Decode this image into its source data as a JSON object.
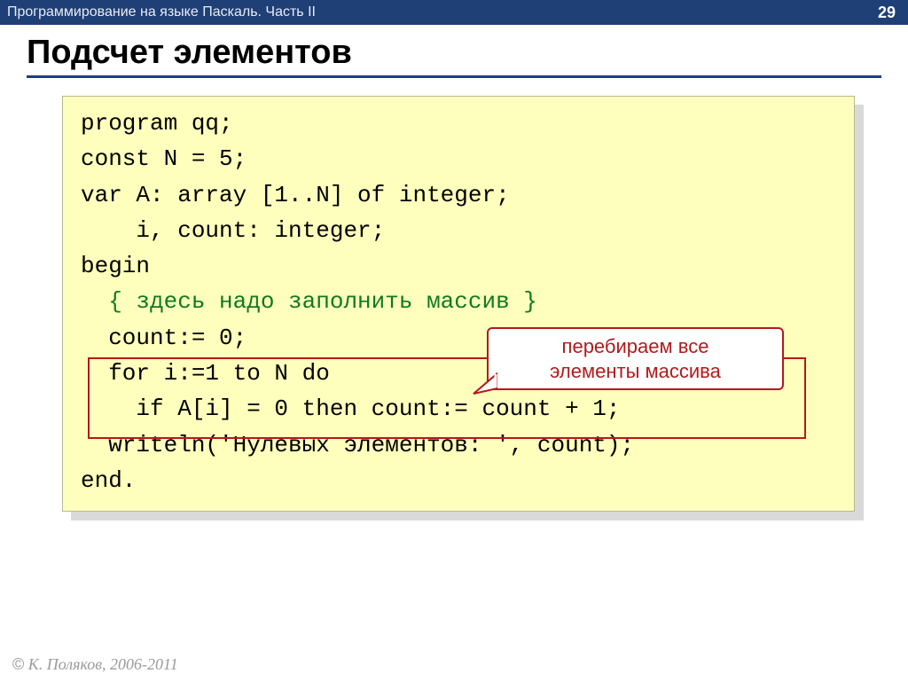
{
  "header": {
    "course": "Программирование на языке Паскаль. Часть II",
    "page_number": "29"
  },
  "title": "Подсчет элементов",
  "code": {
    "l1": "program qq;",
    "l2": "const N = 5;",
    "l3": "var A: array [1..N] of integer;",
    "l4": "    i, count: integer;",
    "l5": "begin",
    "l6": "  { здесь надо заполнить массив }",
    "l7": "  count:= 0;",
    "l8": "  for i:=1 to N do",
    "l9": "    if A[i] = 0 then count:= count + 1;",
    "l10": "  writeln('Нулевых элементов: ', count);",
    "l11": "end."
  },
  "callout": {
    "line1": "перебираем все",
    "line2": "элементы массива"
  },
  "footer": {
    "copyright": "©",
    "text": " К. Поляков, 2006-2011"
  }
}
